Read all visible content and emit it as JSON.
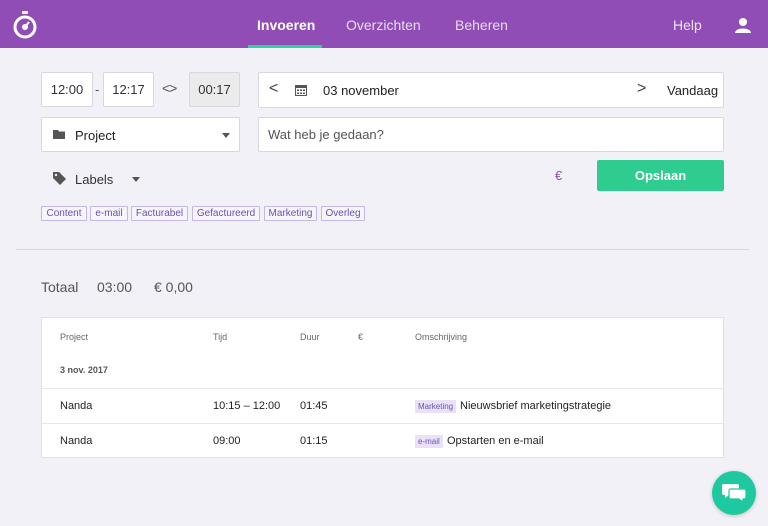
{
  "nav": {
    "items": [
      "Invoeren",
      "Overzichten",
      "Beheren"
    ],
    "help": "Help",
    "accent": "#8f4db5",
    "active_underline": "#2ed1a0"
  },
  "entry": {
    "start": "12:00",
    "dash": "-",
    "end": "12:17",
    "swap": "<>",
    "duration": "00:17",
    "date_prev": "<",
    "date": "03 november",
    "date_next": ">",
    "today": "Vandaag",
    "project": "Project",
    "description_placeholder": "Wat heb je gedaan?",
    "labels": "Labels",
    "euro": "€",
    "save": "Opslaan",
    "chips": [
      "Content",
      "e-mail",
      "Facturabel",
      "Gefactureerd",
      "Marketing",
      "Overleg"
    ]
  },
  "totals": {
    "label": "Totaal",
    "time": "03:00",
    "amount": "€ 0,00"
  },
  "table": {
    "headers": [
      "Project",
      "Tijd",
      "Duur",
      "€",
      "Omschrijving"
    ],
    "group": "3 nov. 2017",
    "rows": [
      {
        "project": "Nanda",
        "time": "10:15 – 12:00",
        "duration": "01:45",
        "tag": "Marketing",
        "description": "Nieuwsbrief marketingstrategie"
      },
      {
        "project": "Nanda",
        "time": "09:00",
        "duration": "01:15",
        "tag": "e-mail",
        "description": "Opstarten en e-mail"
      }
    ]
  },
  "icons": {
    "logo": "stopwatch-icon",
    "user": "user-icon",
    "calendar": "calendar-icon",
    "folder": "folder-icon",
    "tag": "tag-icon",
    "chat": "chat-icon"
  }
}
